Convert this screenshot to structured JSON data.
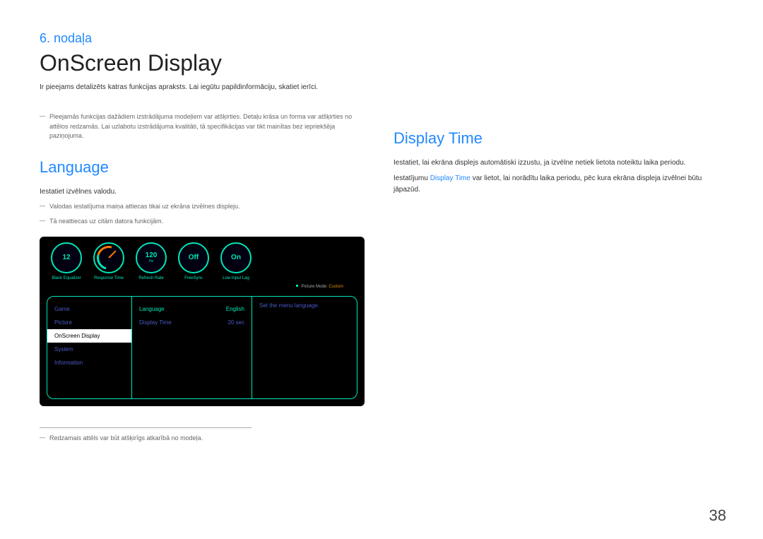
{
  "chapter": "6. nodaļa",
  "title": "OnScreen Display",
  "intro": "Ir pieejams detalizēts katras funkcijas apraksts. Lai iegūtu papildinformāciju, skatiet ierīci.",
  "top_note": "Pieejamās funkcijas dažādiem izstrādājuma modeļiem var atšķirties. Detaļu krāsa un forma var atšķirties no attēlos redzamās. Lai uzlabotu izstrādājuma kvalitāti, tā specifikācijas var tikt mainītas bez iepriekšēja paziņojuma.",
  "left": {
    "heading": "Language",
    "p1": "Iestatiet izvēlnes valodu.",
    "n1": "Valodas iestatījuma maiņa attiecas tikai uz ekrāna izvēlnes displeju.",
    "n2": "Tā neattiecas uz citām datora funkcijām.",
    "footnote": "Redzamais attēls var būt atšķirīgs atkarībā no modeļa."
  },
  "right": {
    "heading": "Display Time",
    "p1": "Iestatiet, lai ekrāna displejs automātiski izzustu, ja izvēlne netiek lietota noteiktu laika periodu.",
    "p2a": "Iestatījumu ",
    "p2_hl": "Display Time",
    "p2b": " var lietot, lai norādītu laika periodu, pēc kura ekrāna displeja izvēlnei būtu jāpazūd."
  },
  "osd": {
    "dials": [
      {
        "value": "12",
        "sub": "",
        "label": "Black Equalizer"
      },
      {
        "value": "",
        "sub": "",
        "label": "Response Time",
        "gauge": true
      },
      {
        "value": "120",
        "sub": "Hz",
        "label": "Refresh Rate"
      },
      {
        "value": "Off",
        "sub": "",
        "label": "FreeSync"
      },
      {
        "value": "On",
        "sub": "",
        "label": "Low Input Lag"
      }
    ],
    "picmode_label": "Picture Mode: ",
    "picmode_value": "Custom",
    "nav": [
      "Game",
      "Picture",
      "OnScreen Display",
      "System",
      "Information"
    ],
    "nav_selected": 2,
    "options": [
      {
        "label": "Language",
        "value": "English",
        "selected": true
      },
      {
        "label": "Display Time",
        "value": "20 sec",
        "selected": false
      }
    ],
    "desc": "Set the menu language."
  },
  "page_number": "38"
}
